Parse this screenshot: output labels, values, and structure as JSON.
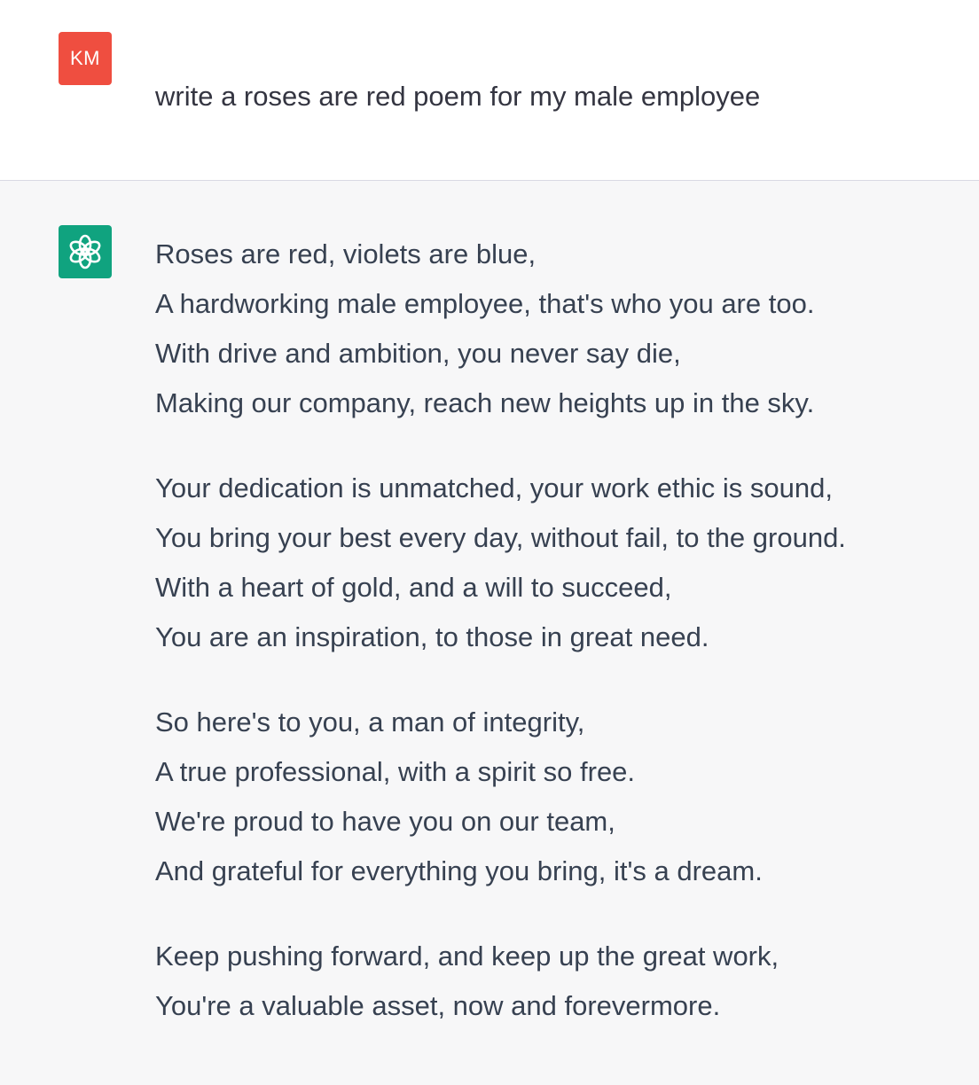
{
  "user": {
    "avatar_initials": "KM",
    "avatar_color": "#ef4e40",
    "message": "write a roses are red poem for my male employee"
  },
  "assistant": {
    "avatar_icon": "openai-logo-icon",
    "avatar_color": "#10a37f",
    "stanzas": [
      [
        "Roses are red, violets are blue,",
        "A hardworking male employee, that's who you are too.",
        "With drive and ambition, you never say die,",
        "Making our company, reach new heights up in the sky."
      ],
      [
        "Your dedication is unmatched, your work ethic is sound,",
        "You bring your best every day, without fail, to the ground.",
        "With a heart of gold, and a will to succeed,",
        "You are an inspiration, to those in great need."
      ],
      [
        "So here's to you, a man of integrity,",
        "A true professional, with a spirit so free.",
        "We're proud to have you on our team,",
        "And grateful for everything you bring, it's a dream."
      ],
      [
        "Keep pushing forward, and keep up the great work,",
        "You're a valuable asset, now and forevermore."
      ]
    ]
  }
}
